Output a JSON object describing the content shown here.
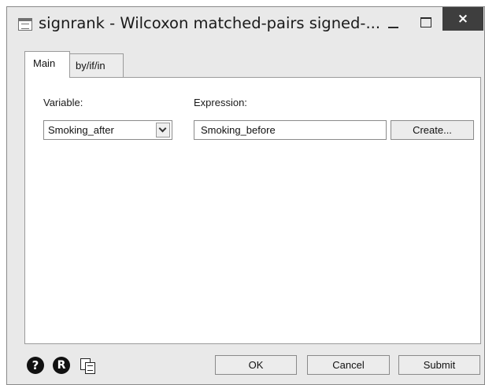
{
  "window": {
    "title": "signrank - Wilcoxon matched-pairs signed-...",
    "close_glyph": "×"
  },
  "tabs": [
    {
      "label": "Main",
      "selected": true
    },
    {
      "label": "by/if/in",
      "selected": false
    }
  ],
  "main": {
    "variable": {
      "label": "Variable:",
      "value": "Smoking_after"
    },
    "expression": {
      "label": "Expression:",
      "value": "Smoking_before"
    },
    "create_label": "Create..."
  },
  "footer": {
    "help_glyph": "?",
    "reset_glyph": "R",
    "ok_label": "OK",
    "cancel_label": "Cancel",
    "submit_label": "Submit"
  },
  "icons": {
    "app": "dialog-window-icon",
    "help": "help-icon",
    "reset": "reset-icon",
    "copy": "copy-command-icon",
    "dropdown": "chevron-down-icon"
  },
  "colors": {
    "window_bg": "#e9e9e9",
    "panel_bg": "#ffffff",
    "close_bg": "#3e3e3e",
    "border": "#8a8a8a"
  }
}
